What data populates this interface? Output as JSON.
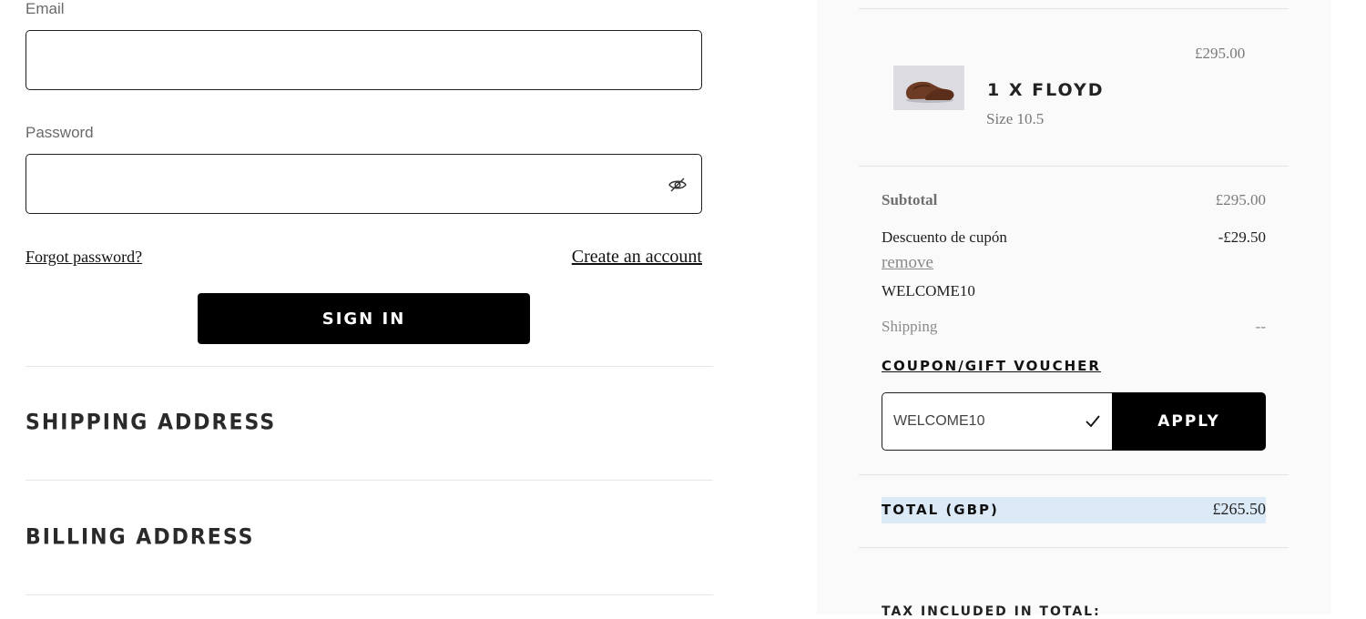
{
  "login": {
    "email_label": "Email",
    "email_value": "",
    "password_label": "Password",
    "password_value": "",
    "forgot_label": "Forgot password?",
    "create_account_label": "Create an account",
    "sign_in_label": "SIGN IN"
  },
  "sections": {
    "shipping_title": "SHIPPING ADDRESS",
    "billing_title": "BILLING ADDRESS"
  },
  "order": {
    "item": {
      "price": "£295.00",
      "title": "1 X FLOYD",
      "size": "Size 10.5",
      "image_name": "brown-loafer-shoe"
    },
    "subtotal_label": "Subtotal",
    "subtotal_value": "£295.00",
    "discount_label": "Descuento de cupón",
    "discount_value": "-£29.50",
    "remove_label": "remove",
    "coupon_code_applied": "WELCOME10",
    "shipping_label": "Shipping",
    "shipping_value": "--",
    "coupon_heading": "COUPON/GIFT VOUCHER",
    "coupon_input_value": "WELCOME10",
    "apply_label": "APPLY",
    "total_label": "TOTAL (GBP)",
    "total_value": "£265.50",
    "tax_label_partial": "TAX INCLUDED IN TOTAL:"
  },
  "colors": {
    "button_bg": "#000000",
    "panel_bg": "#fafafa",
    "total_highlight": "#dce9f7"
  }
}
